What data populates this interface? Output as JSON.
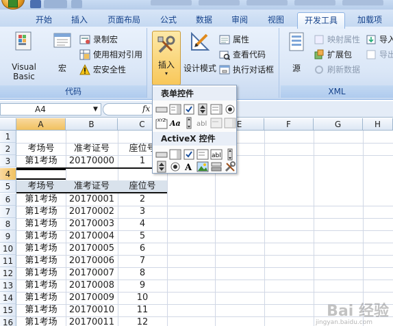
{
  "tabs": [
    {
      "label": "开始",
      "key": "home"
    },
    {
      "label": "插入",
      "key": "insert"
    },
    {
      "label": "页面布局",
      "key": "layout"
    },
    {
      "label": "公式",
      "key": "formula"
    },
    {
      "label": "数据",
      "key": "data"
    },
    {
      "label": "审阅",
      "key": "review"
    },
    {
      "label": "视图",
      "key": "view"
    },
    {
      "label": "开发工具",
      "key": "developer"
    },
    {
      "label": "加载项",
      "key": "addins"
    }
  ],
  "ribbon": {
    "code": {
      "label": "代码",
      "visual_basic": "Visual Basic",
      "macros": "宏",
      "record_macro": "录制宏",
      "relative_ref": "使用相对引用",
      "macro_security": "宏安全性"
    },
    "controls": {
      "insert": "插入",
      "design_mode": "设计模式",
      "properties": "属性",
      "view_code": "查看代码",
      "run_dialog": "执行对话框"
    },
    "xml": {
      "label": "XML",
      "source": "源",
      "map_properties": "映射属性",
      "expansion_packs": "扩展包",
      "refresh_data": "刷新数据",
      "import": "导入",
      "export": "导出"
    }
  },
  "formula_bar": {
    "name_box": "A4",
    "fx": "fx"
  },
  "dropdown": {
    "form_controls_title": "表单控件",
    "activex_title": "ActiveX 控件"
  },
  "sheet": {
    "columns": [
      "A",
      "B",
      "C",
      "D",
      "E",
      "F",
      "G",
      "H"
    ],
    "rows": [
      {
        "n": "1",
        "a": "",
        "b": "",
        "c": ""
      },
      {
        "n": "2",
        "a": "考场号",
        "b": "准考证号",
        "c": "座位号"
      },
      {
        "n": "3",
        "a": "第1考场",
        "b": "20170000",
        "c": "1"
      },
      {
        "n": "4",
        "a": "",
        "b": "",
        "c": ""
      },
      {
        "n": "5",
        "a": "考场号",
        "b": "准考证号",
        "c": "座位号"
      },
      {
        "n": "6",
        "a": "第1考场",
        "b": "20170001",
        "c": "2"
      },
      {
        "n": "7",
        "a": "第1考场",
        "b": "20170002",
        "c": "3"
      },
      {
        "n": "8",
        "a": "第1考场",
        "b": "20170003",
        "c": "4"
      },
      {
        "n": "9",
        "a": "第1考场",
        "b": "20170004",
        "c": "5"
      },
      {
        "n": "10",
        "a": "第1考场",
        "b": "20170005",
        "c": "6"
      },
      {
        "n": "11",
        "a": "第1考场",
        "b": "20170006",
        "c": "7"
      },
      {
        "n": "12",
        "a": "第1考场",
        "b": "20170007",
        "c": "8"
      },
      {
        "n": "13",
        "a": "第1考场",
        "b": "20170008",
        "c": "9"
      },
      {
        "n": "14",
        "a": "第1考场",
        "b": "20170009",
        "c": "10"
      },
      {
        "n": "15",
        "a": "第1考场",
        "b": "20170010",
        "c": "11"
      },
      {
        "n": "16",
        "a": "第1考场",
        "b": "20170011",
        "c": "12"
      }
    ]
  },
  "watermark": {
    "text": "Bai 经验",
    "sub": "jingyan.baidu.com"
  },
  "colors": {
    "accent": "#15428b",
    "selection": "#f1c15f",
    "ribbon": "#dbe7f7"
  }
}
